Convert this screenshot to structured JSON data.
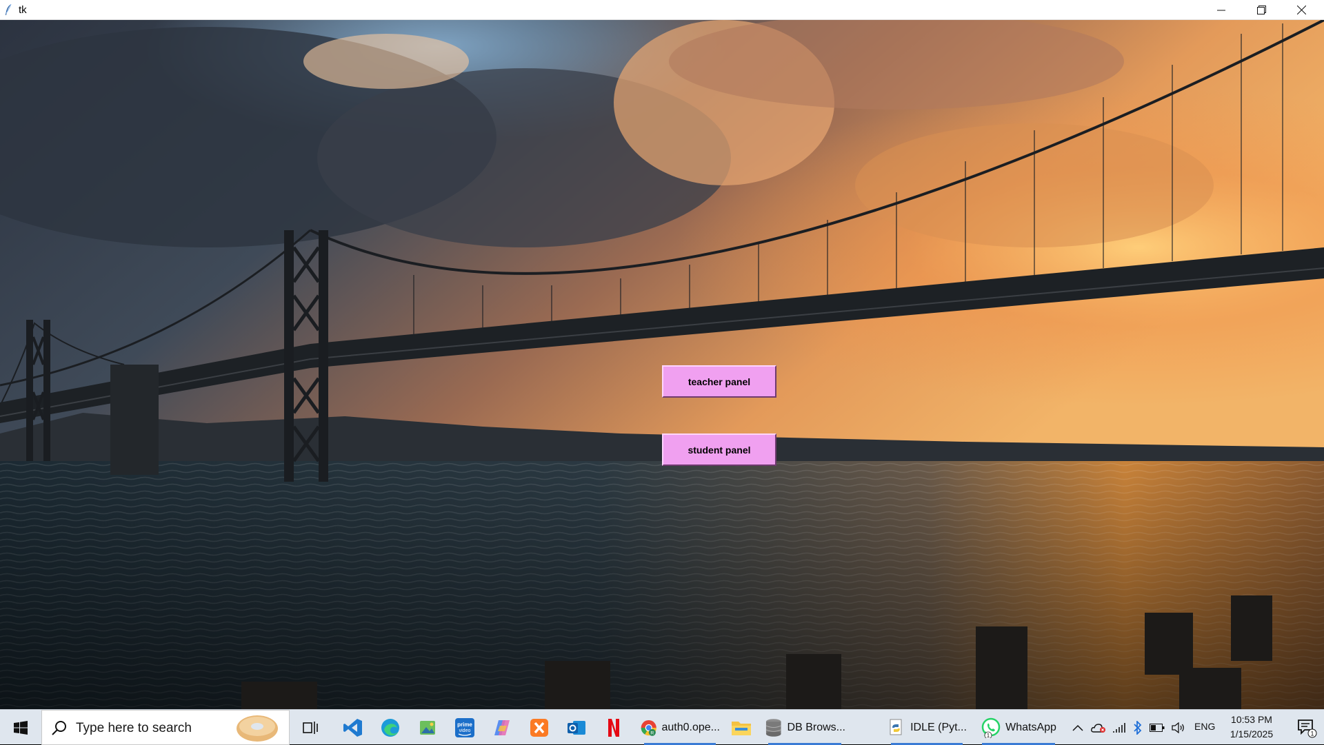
{
  "window": {
    "title": "tk"
  },
  "buttons": {
    "teacher": "teacher panel",
    "student": "student panel"
  },
  "taskbar": {
    "search_placeholder": "Type here to search",
    "apps": {
      "chrome": "auth0.ope...",
      "db_browser": "DB Brows...",
      "idle": "IDLE (Pyt...",
      "whatsapp": "WhatsApp"
    },
    "whatsapp_badge": "1",
    "notification_badge": "1",
    "language": "ENG",
    "time": "10:53 PM",
    "date": "1/15/2025"
  },
  "colors": {
    "button_bg": "#f0a0f0",
    "taskbar_bg": "#dfe6ee",
    "accent": "#3a7bd5"
  },
  "icons": [
    "tk-feather-icon",
    "minimize-icon",
    "maximize-icon",
    "close-icon",
    "windows-start-icon",
    "search-icon",
    "task-view-icon",
    "vscode-icon",
    "edge-icon",
    "photos-icon",
    "prime-video-icon",
    "copilot-icon",
    "xampp-icon",
    "outlook-icon",
    "netflix-icon",
    "chrome-icon",
    "file-explorer-icon",
    "db-browser-icon",
    "python-idle-icon",
    "whatsapp-icon",
    "chevron-up-icon",
    "onedrive-icon",
    "wifi-icon",
    "bluetooth-icon",
    "battery-icon",
    "volume-icon",
    "notifications-icon"
  ]
}
